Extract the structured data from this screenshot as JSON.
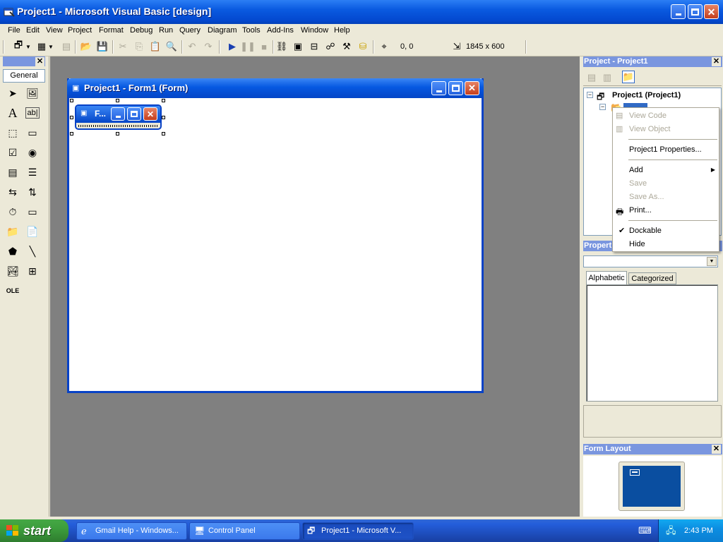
{
  "app": {
    "title": "Project1 - Microsoft Visual Basic [design]",
    "icon": "vb-icon",
    "window_buttons": [
      "minimize-icon",
      "maximize-icon",
      "close-icon"
    ]
  },
  "menu": [
    {
      "key": "file",
      "label": "File"
    },
    {
      "key": "edit",
      "label": "Edit"
    },
    {
      "key": "view",
      "label": "View"
    },
    {
      "key": "project",
      "label": "Project"
    },
    {
      "key": "format",
      "label": "Format"
    },
    {
      "key": "debug",
      "label": "Debug"
    },
    {
      "key": "run",
      "label": "Run"
    },
    {
      "key": "query",
      "label": "Query"
    },
    {
      "key": "diagram",
      "label": "Diagram"
    },
    {
      "key": "tools",
      "label": "Tools"
    },
    {
      "key": "addins",
      "label": "Add-Ins"
    },
    {
      "key": "window",
      "label": "Window"
    },
    {
      "key": "help",
      "label": "Help"
    }
  ],
  "toolbar": {
    "position": "0, 0",
    "size": "1845 x 600"
  },
  "toolbox": {
    "tab_label": "General"
  },
  "form_designer": {
    "window_title": "Project1 - Form1 (Form)",
    "inner_form_caption": "F..."
  },
  "project_explorer": {
    "title": "Project - Project1",
    "root_node": "Project1 (Project1)"
  },
  "context_menu": {
    "items": [
      {
        "label": "View Code",
        "enabled": false
      },
      {
        "label": "View Object",
        "enabled": false
      },
      {
        "label": "Project1 Properties...",
        "enabled": true
      },
      {
        "label": "Add",
        "enabled": true,
        "submenu": true
      },
      {
        "label": "Save",
        "enabled": false
      },
      {
        "label": "Save As...",
        "enabled": false
      },
      {
        "label": "Print...",
        "enabled": true
      },
      {
        "label": "Dockable",
        "enabled": true,
        "checked": true
      },
      {
        "label": "Hide",
        "enabled": true
      }
    ]
  },
  "properties": {
    "title": "Propert",
    "tabs": [
      "Alphabetic",
      "Categorized"
    ]
  },
  "form_layout": {
    "title": "Form Layout"
  },
  "taskbar": {
    "start_label": "start",
    "tasks": [
      {
        "label": "Gmail Help - Windows...",
        "active": false
      },
      {
        "label": "Control Panel",
        "active": false
      },
      {
        "label": "Project1 - Microsoft V...",
        "active": true
      }
    ],
    "clock": "2:43 PM"
  },
  "colors": {
    "xp_blue": "#0a5ae0",
    "workspace_gray": "#808080",
    "panel_header": "#7a96df",
    "taskbar_blue": "#245edb",
    "start_green": "#3c9d3c"
  }
}
